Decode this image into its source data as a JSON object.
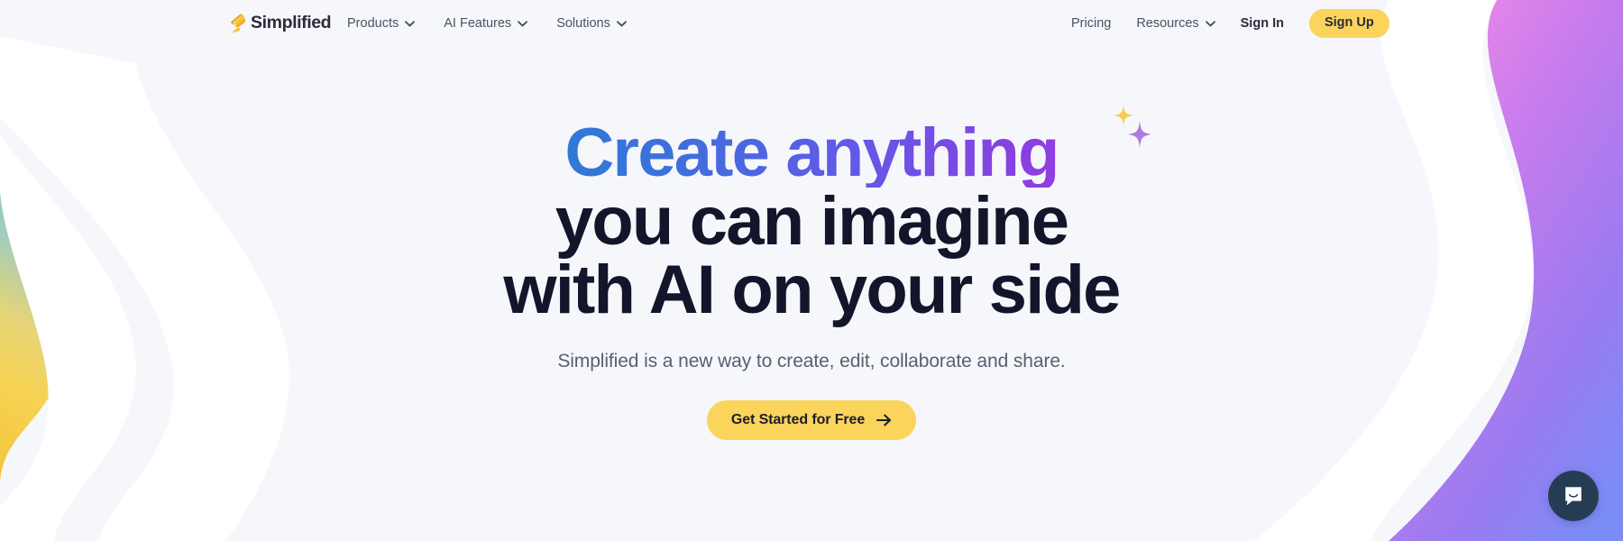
{
  "colors": {
    "page_background": "#f6f7fb",
    "accent_yellow": "#fbd45c",
    "headline_dark": "#14142b",
    "gradient_start_blue": "#2a7fd4",
    "gradient_end_purple": "#9a3de2",
    "sparkle_gold": "#f5d04e",
    "sparkle_purple": "#b07be0",
    "chat_bubble_navy": "#253d53",
    "blob_pink": "#ef85e8",
    "blob_purple": "#9b7bf0",
    "blob_blue": "#7f8ff5",
    "blob_teal": "#74c4d2",
    "blob_yellow": "#f5cf4a"
  },
  "navbar": {
    "brand": {
      "name": "Simplified",
      "logo_icon": "simplified-bolt-logo"
    },
    "primary_items": [
      {
        "label": "Products",
        "has_dropdown": true,
        "icon": "chevron-down-icon"
      },
      {
        "label": "AI Features",
        "has_dropdown": true,
        "icon": "chevron-down-icon"
      },
      {
        "label": "Solutions",
        "has_dropdown": true,
        "icon": "chevron-down-icon"
      }
    ],
    "secondary_items": [
      {
        "label": "Pricing",
        "has_dropdown": false
      },
      {
        "label": "Resources",
        "has_dropdown": true,
        "icon": "chevron-down-icon"
      },
      {
        "label": "Sign In",
        "has_dropdown": false
      }
    ],
    "signup_label": "Sign Up"
  },
  "hero": {
    "headline_line1": "Create anything",
    "headline_line2": "you can imagine",
    "headline_line3": "with AI on your side",
    "sparkle_gold_icon": "sparkle-star-icon",
    "sparkle_purple_icon": "sparkle-star-icon",
    "subtitle": "Simplified is a new way to create, edit, collaborate and share.",
    "cta_label": "Get Started for Free",
    "cta_icon": "arrow-right-icon"
  },
  "chat": {
    "icon": "chat-bubble-smile-icon"
  }
}
